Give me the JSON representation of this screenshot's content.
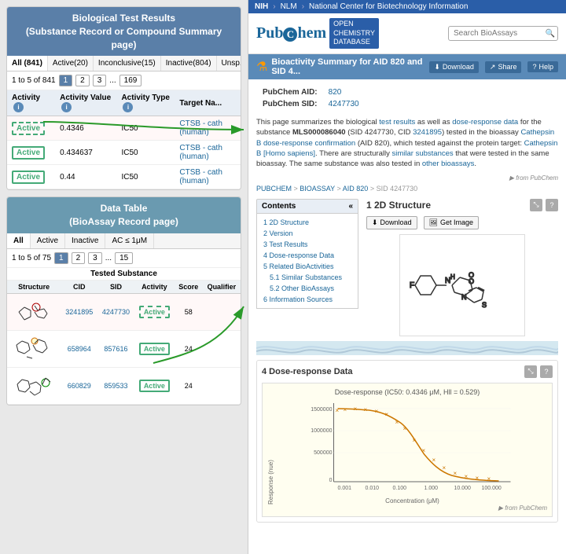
{
  "left": {
    "bio_header_line1": "Biological Test Results",
    "bio_header_line2": "(Substance Record or Compound Summary page)",
    "tabs": [
      {
        "label": "All (841)",
        "active": true
      },
      {
        "label": "Active(20)",
        "active": false
      },
      {
        "label": "Inconclusive(15)",
        "active": false
      },
      {
        "label": "Inactive(804)",
        "active": false
      },
      {
        "label": "Unsp...",
        "active": false
      }
    ],
    "pagination_text": "1 to 5 of 841",
    "pages": [
      "1",
      "2",
      "3",
      "...",
      "169"
    ],
    "table_headers": [
      "Activity",
      "Activity Value",
      "Activity Type",
      "Target Na..."
    ],
    "rows": [
      {
        "activity": "Active",
        "value": "0.4346",
        "type": "IC50",
        "target": "CTSB - cath (human)",
        "highlight": true
      },
      {
        "activity": "Active",
        "value": "0.434637",
        "type": "IC50",
        "target": "CTSB - cath (human)"
      },
      {
        "activity": "Active",
        "value": "0.44",
        "type": "IC50",
        "target": "CTSB - cath (human)"
      }
    ],
    "data_header_line1": "Data Table",
    "data_header_line2": "(BioAssay Record page)",
    "data_tabs": [
      "All",
      "Active",
      "Inactive",
      "AC ≤ 1μM"
    ],
    "data_pagination": "1 to 5 of 75",
    "data_pages": [
      "1",
      "2",
      "3",
      "...",
      "15"
    ],
    "data_col_headers": [
      "Structure",
      "CID",
      "SID",
      "Activity",
      "Score",
      "Qualifier"
    ],
    "data_rows": [
      {
        "cid": "3241895",
        "sid": "4247730",
        "activity": "Active",
        "score": "58",
        "highlight": true
      },
      {
        "cid": "658964",
        "sid": "857616",
        "activity": "Active",
        "score": "24"
      },
      {
        "cid": "660829",
        "sid": "859533",
        "activity": "Active",
        "score": "24"
      }
    ]
  },
  "right": {
    "nih_items": [
      "NIH",
      "NLM",
      "National Center for Biotechnology Information"
    ],
    "search_placeholder": "Search BioAssays",
    "blue_bar_title": "Bioactivity Summary for AID 820 and SID 4...",
    "bar_actions": [
      "Download",
      "Share",
      "Help"
    ],
    "pubchem_aid_label": "PubChem AID:",
    "pubchem_aid_value": "820",
    "pubchem_sid_label": "PubChem SID:",
    "pubchem_sid_value": "4247730",
    "description": "This page summarizes the biological test results as well as dose-response data for the substance MLS000086040 (SID 4247730, CID 3241895) tested in the bioassay Cathepsin B dose-response confirmation (AID 820), which tested against the protein target: Cathepsin B [Homo sapiens]. There are structurally similar substances that were tested in the same bioassay. The same substance was also tested in other bioassays.",
    "from_pubchem": "▶ from PubChem",
    "breadcrumb": "PUBCHEM > BIOASSAY > AID 820 > SID 4247730",
    "contents_title": "Contents",
    "contents_items": [
      "1 2D Structure",
      "2 Version",
      "3 Test Results",
      "4 Dose-response Data",
      "5 Related BioActivities",
      "  5.1 Similar Substances",
      "  5.2 Other BioAssays",
      "6 Information Sources"
    ],
    "struct_section": "1  2D Structure",
    "struct_actions": [
      "Download",
      "Get Image"
    ],
    "dose_section": "4  Dose-response Data",
    "chart_title": "Dose-response (IC50: 0.4346 μM, Hll = 0.529)",
    "y_axis_label": "Response (nue)",
    "x_axis_label": "Concentration (μM)",
    "y_ticks": [
      "1500000",
      "1000000",
      "500000",
      "0"
    ],
    "x_ticks": [
      "0.001",
      "0.010",
      "0.100",
      "1.000",
      "10.000",
      "100.000"
    ],
    "from_pubchem2": "▶ from PubChem"
  }
}
